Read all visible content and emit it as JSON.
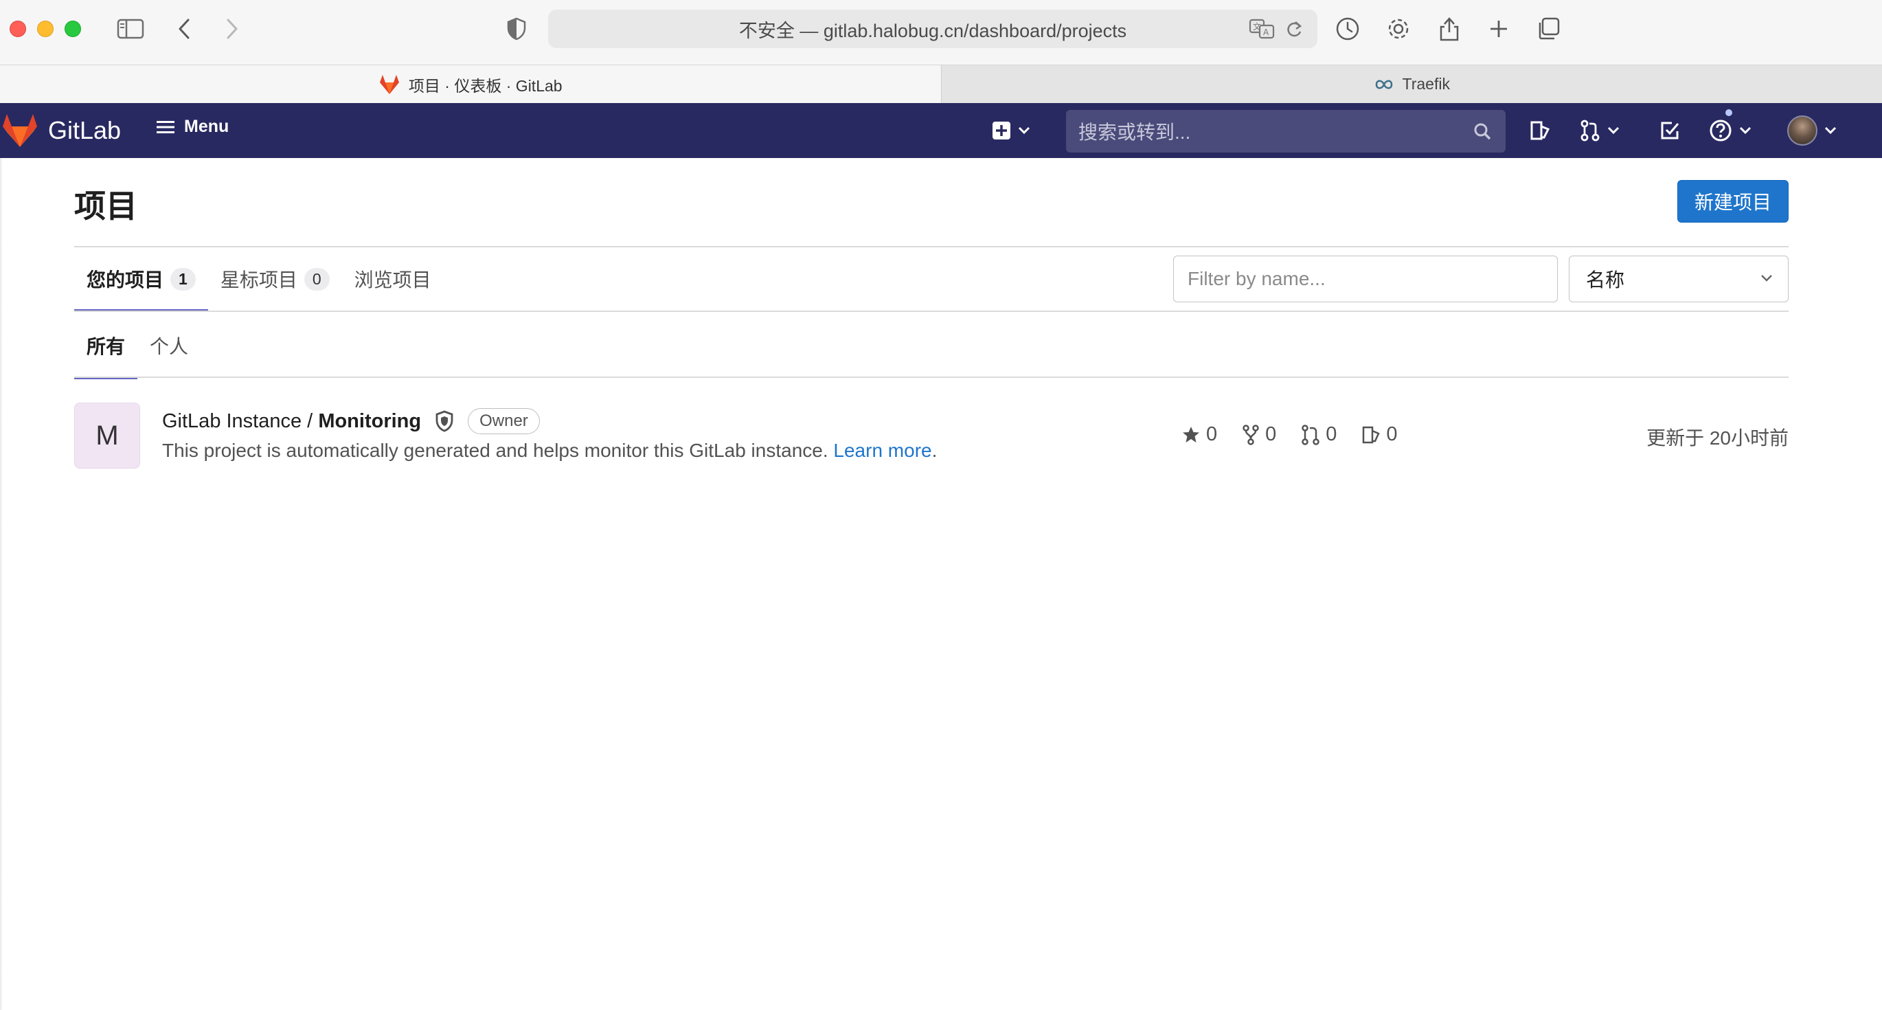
{
  "browser": {
    "url_text": "不安全 — gitlab.halobug.cn/dashboard/projects",
    "tabs": [
      {
        "label": "项目 · 仪表板 · GitLab",
        "active": true,
        "icon": "gitlab-fox-icon"
      },
      {
        "label": "Traefik",
        "active": false,
        "icon": "traefik-icon"
      }
    ]
  },
  "navbar": {
    "brand": "GitLab",
    "menu_label": "Menu",
    "search_placeholder": "搜索或转到..."
  },
  "page": {
    "title": "项目",
    "new_project_label": "新建项目",
    "tabs": [
      {
        "label": "您的项目",
        "count": "1"
      },
      {
        "label": "星标项目",
        "count": "0"
      },
      {
        "label": "浏览项目"
      }
    ],
    "filter_placeholder": "Filter by name...",
    "sort_selected": "名称",
    "sub_tabs": [
      {
        "label": "所有"
      },
      {
        "label": "个人"
      }
    ]
  },
  "project": {
    "avatar_letter": "M",
    "namespace": "GitLab Instance / ",
    "name": "Monitoring",
    "role_badge": "Owner",
    "description": "This project is automatically generated and helps monitor this GitLab instance.",
    "learn_more": "Learn more",
    "desc_suffix": ".",
    "stars": "0",
    "forks": "0",
    "merge_requests": "0",
    "issues": "0",
    "updated": "更新于 20小时前"
  },
  "colors": {
    "navbar_bg": "#292961",
    "primary_button": "#1f75cb",
    "active_tab_underline": "#6666c4"
  }
}
